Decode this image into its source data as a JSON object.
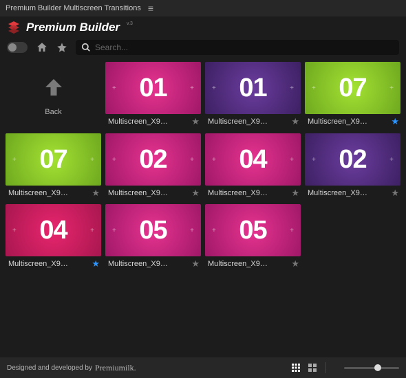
{
  "window": {
    "title": "Premium Builder Multiscreen Transitions"
  },
  "brand": {
    "title": "Premium Builder",
    "version": "v.3"
  },
  "search": {
    "placeholder": "Search..."
  },
  "back": {
    "label": "Back"
  },
  "items": [
    {
      "num": "01",
      "label": "Multiscreen_X9…",
      "color": "magenta",
      "favorite": false
    },
    {
      "num": "01",
      "label": "Multiscreen_X9…",
      "color": "purple",
      "favorite": false
    },
    {
      "num": "07",
      "label": "Multiscreen_X9…",
      "color": "green",
      "favorite": true
    },
    {
      "num": "07",
      "label": "Multiscreen_X9…",
      "color": "green",
      "favorite": false
    },
    {
      "num": "02",
      "label": "Multiscreen_X9…",
      "color": "magenta",
      "favorite": false
    },
    {
      "num": "04",
      "label": "Multiscreen_X9…",
      "color": "magenta",
      "favorite": false
    },
    {
      "num": "02",
      "label": "Multiscreen_X9…",
      "color": "purple",
      "favorite": false
    },
    {
      "num": "04",
      "label": "Multiscreen_X9…",
      "color": "pink",
      "favorite": true
    },
    {
      "num": "05",
      "label": "Multiscreen_X9…",
      "color": "magenta",
      "favorite": false
    },
    {
      "num": "05",
      "label": "Multiscreen_X9…",
      "color": "magenta",
      "favorite": false
    }
  ],
  "footer": {
    "credit_prefix": "Designed and developed by ",
    "credit_name": "Premiumilk."
  },
  "colors": {
    "accent_blue": "#2d95ff",
    "logo_red": "#e03a3e"
  }
}
